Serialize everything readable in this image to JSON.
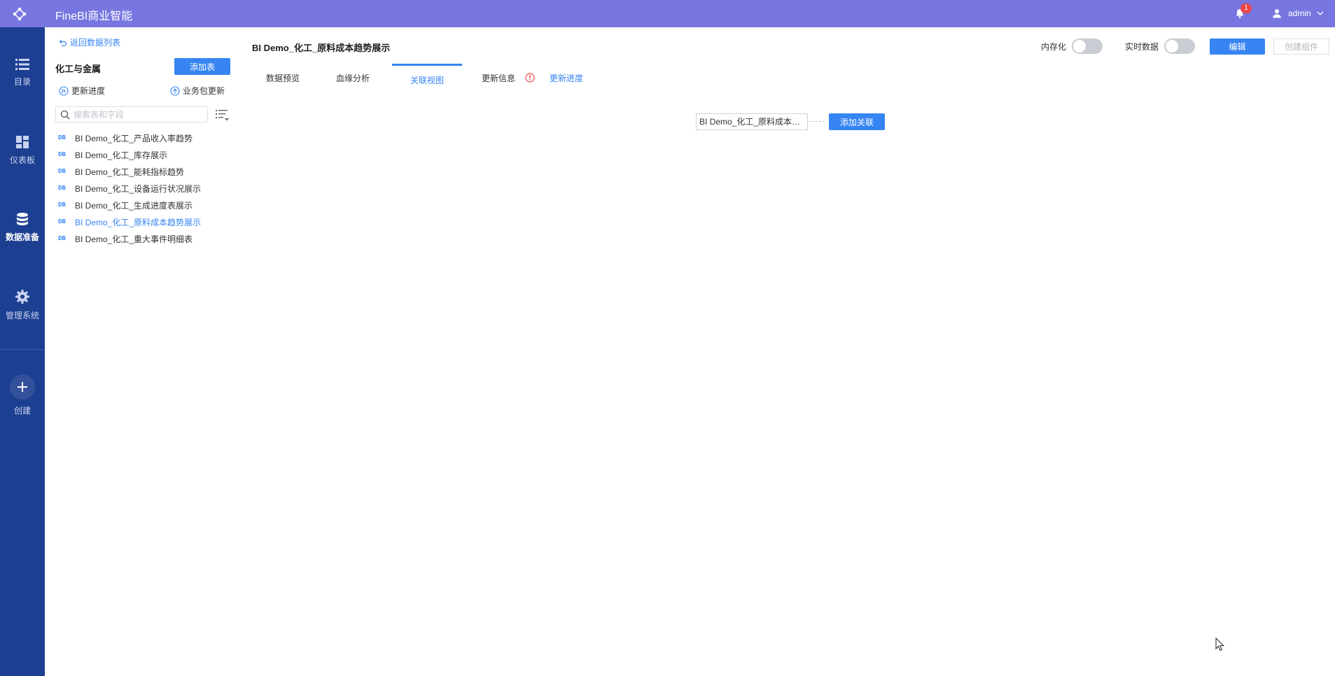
{
  "topbar": {
    "title": "FineBI商业智能",
    "notification_count": "1",
    "user_name": "admin"
  },
  "nav": {
    "items": [
      {
        "label": "目录",
        "icon": "list-icon"
      },
      {
        "label": "仪表板",
        "icon": "dashboard-icon"
      },
      {
        "label": "数据准备",
        "icon": "database-icon",
        "active": true
      },
      {
        "label": "管理系统",
        "icon": "gear-icon"
      }
    ],
    "create_label": "创建"
  },
  "package": {
    "back_label": "返回数据列表",
    "title": "化工与金属",
    "add_table_label": "添加表",
    "update_progress_label": "更新进度",
    "pkg_update_label": "业务包更新",
    "search_placeholder": "搜索表和字段",
    "db_badge": "DB",
    "tables": [
      "BI Demo_化工_产品收入率趋势",
      "BI Demo_化工_库存展示",
      "BI Demo_化工_能耗指标趋势",
      "BI Demo_化工_设备运行状况展示",
      "BI Demo_化工_生成进度表展示",
      "BI Demo_化工_原料成本趋势展示",
      "BI Demo_化工_重大事件明细表"
    ],
    "active_table": "BI Demo_化工_原料成本趋势展示"
  },
  "main": {
    "title": "BI Demo_化工_原料成本趋势展示",
    "toggle_persist_label": "内存化",
    "toggle_realtime_label": "实时数据",
    "edit_label": "编辑",
    "create_component_label": "创建组件",
    "tabs": [
      {
        "label": "数据预览"
      },
      {
        "label": "血缘分析"
      },
      {
        "label": "关联视图",
        "active": true
      },
      {
        "label": "更新信息"
      }
    ],
    "update_progress_link": "更新进度",
    "relation_node_label": "BI Demo_化工_原料成本趋势展示",
    "add_relation_label": "添加关联"
  },
  "colors": {
    "topbar": "#7776e0",
    "sidebar": "#1d3f91",
    "accent": "#3685f2",
    "alert": "#ee4444"
  }
}
